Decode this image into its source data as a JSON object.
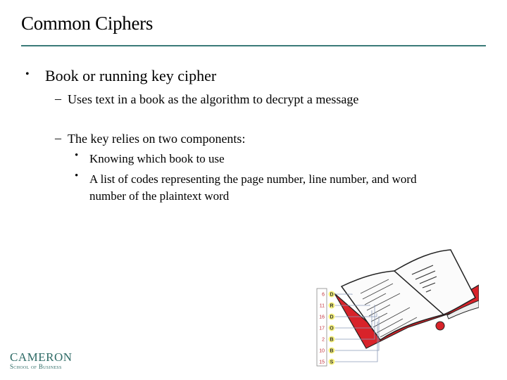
{
  "slide": {
    "title": "Common Ciphers",
    "bullets": {
      "main": "Book or running key cipher",
      "sub1": "Uses text in a book as the algorithm to decrypt a message",
      "sub2": "The key relies on two components:",
      "subsub1": "Knowing which book to use",
      "subsub2": "A list of codes representing the page number, line number, and word number of the plaintext word"
    },
    "markers": {
      "bullet": "•",
      "dash": "–",
      "dot": "•"
    }
  },
  "illustration": {
    "description": "open-book-cipher-illustration",
    "codes": [
      {
        "number": "6",
        "letter": "D"
      },
      {
        "number": "11",
        "letter": "R"
      },
      {
        "number": "16",
        "letter": "D"
      },
      {
        "number": "17",
        "letter": "O"
      },
      {
        "number": "2",
        "letter": "B"
      },
      {
        "number": "10",
        "letter": "B"
      },
      {
        "number": "15",
        "letter": "S"
      }
    ],
    "colors": {
      "cover": "#d8232a",
      "highlight": "#f5f07a",
      "number": "#c0303a",
      "lines": "#8a9ab8"
    }
  },
  "logo": {
    "name": "CAMERON",
    "subtitle": "School of Business",
    "color": "#2e6b66"
  },
  "theme": {
    "rule_color": "#3a7a78"
  }
}
